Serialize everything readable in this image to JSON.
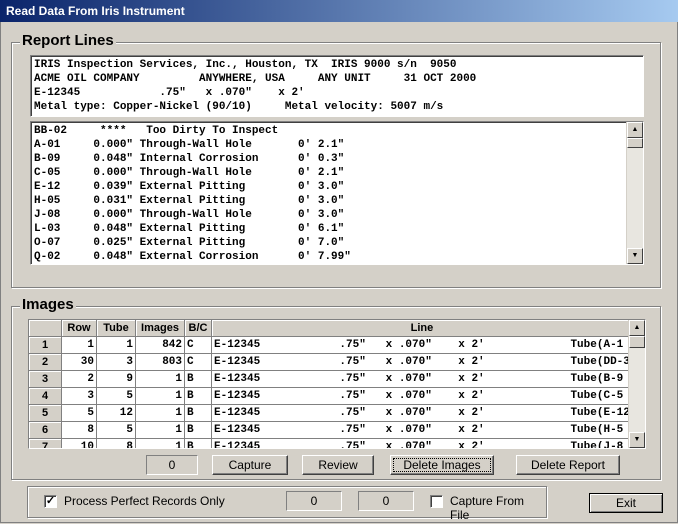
{
  "window": {
    "title": "Read Data From Iris Instrument"
  },
  "report": {
    "group_title": "Report Lines",
    "header_lines": [
      "IRIS Inspection Services, Inc., Houston, TX  IRIS 9000 s/n  9050",
      "ACME OIL COMPANY         ANYWHERE, USA     ANY UNIT     31 OCT 2000",
      "E-12345            .75\"   x .070\"    x 2'",
      "Metal type: Copper-Nickel (90/10)     Metal velocity: 5007 m/s"
    ],
    "lines": [
      "BB-02     ****   Too Dirty To Inspect",
      "A-01     0.000\" Through-Wall Hole       0' 2.1\"",
      "B-09     0.048\" Internal Corrosion      0' 0.3\"",
      "C-05     0.000\" Through-Wall Hole       0' 2.1\"",
      "E-12     0.039\" External Pitting        0' 3.0\"",
      "H-05     0.031\" External Pitting        0' 3.0\"",
      "J-08     0.000\" Through-Wall Hole       0' 3.0\"",
      "L-03     0.048\" External Pitting        0' 6.1\"",
      "O-07     0.025\" External Pitting        0' 7.0\"",
      "Q-02     0.048\" External Corrosion      0' 7.99\""
    ]
  },
  "images": {
    "group_title": "Images",
    "columns": [
      "Row",
      "Tube",
      "Images",
      "B/C",
      "Line"
    ],
    "rows": [
      {
        "id": "1",
        "row": "1",
        "tube": "1",
        "images": "842",
        "bc": "C",
        "line": "E-12345            .75\"   x .070\"    x 2'             Tube(A-1"
      },
      {
        "id": "2",
        "row": "30",
        "tube": "3",
        "images": "803",
        "bc": "C",
        "line": "E-12345            .75\"   x .070\"    x 2'             Tube(DD-3"
      },
      {
        "id": "3",
        "row": "2",
        "tube": "9",
        "images": "1",
        "bc": "B",
        "line": "E-12345            .75\"   x .070\"    x 2'             Tube(B-9"
      },
      {
        "id": "4",
        "row": "3",
        "tube": "5",
        "images": "1",
        "bc": "B",
        "line": "E-12345            .75\"   x .070\"    x 2'             Tube(C-5"
      },
      {
        "id": "5",
        "row": "5",
        "tube": "12",
        "images": "1",
        "bc": "B",
        "line": "E-12345            .75\"   x .070\"    x 2'             Tube(E-12"
      },
      {
        "id": "6",
        "row": "8",
        "tube": "5",
        "images": "1",
        "bc": "B",
        "line": "E-12345            .75\"   x .070\"    x 2'             Tube(H-5"
      },
      {
        "id": "7",
        "row": "10",
        "tube": "8",
        "images": "1",
        "bc": "B",
        "line": "E-12345            .75\"   x .070\"    x 2'             Tube(J-8"
      }
    ],
    "count_value": "0",
    "capture_label": "Capture",
    "review_label": "Review",
    "delete_images_label": "Delete Images",
    "delete_report_label": "Delete Report"
  },
  "footer": {
    "process_perfect_label": "Process Perfect Records Only",
    "process_perfect_checked": true,
    "field1_value": "0",
    "field2_value": "0",
    "capture_from_file_label": "Capture From File",
    "capture_from_file_checked": false,
    "exit_label": "Exit"
  }
}
